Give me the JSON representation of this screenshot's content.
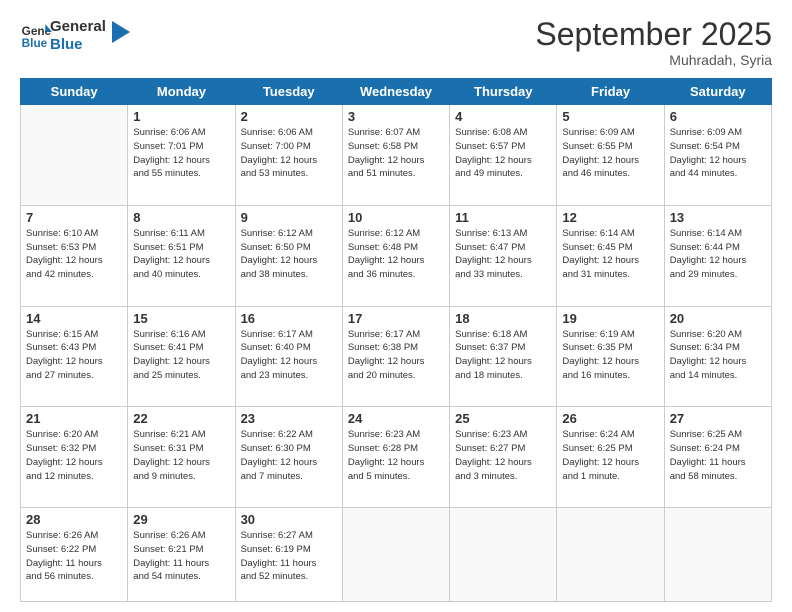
{
  "header": {
    "logo_general": "General",
    "logo_blue": "Blue",
    "month": "September 2025",
    "location": "Muhradah, Syria"
  },
  "days_of_week": [
    "Sunday",
    "Monday",
    "Tuesday",
    "Wednesday",
    "Thursday",
    "Friday",
    "Saturday"
  ],
  "weeks": [
    [
      {
        "day": "",
        "info": ""
      },
      {
        "day": "1",
        "info": "Sunrise: 6:06 AM\nSunset: 7:01 PM\nDaylight: 12 hours\nand 55 minutes."
      },
      {
        "day": "2",
        "info": "Sunrise: 6:06 AM\nSunset: 7:00 PM\nDaylight: 12 hours\nand 53 minutes."
      },
      {
        "day": "3",
        "info": "Sunrise: 6:07 AM\nSunset: 6:58 PM\nDaylight: 12 hours\nand 51 minutes."
      },
      {
        "day": "4",
        "info": "Sunrise: 6:08 AM\nSunset: 6:57 PM\nDaylight: 12 hours\nand 49 minutes."
      },
      {
        "day": "5",
        "info": "Sunrise: 6:09 AM\nSunset: 6:55 PM\nDaylight: 12 hours\nand 46 minutes."
      },
      {
        "day": "6",
        "info": "Sunrise: 6:09 AM\nSunset: 6:54 PM\nDaylight: 12 hours\nand 44 minutes."
      }
    ],
    [
      {
        "day": "7",
        "info": "Sunrise: 6:10 AM\nSunset: 6:53 PM\nDaylight: 12 hours\nand 42 minutes."
      },
      {
        "day": "8",
        "info": "Sunrise: 6:11 AM\nSunset: 6:51 PM\nDaylight: 12 hours\nand 40 minutes."
      },
      {
        "day": "9",
        "info": "Sunrise: 6:12 AM\nSunset: 6:50 PM\nDaylight: 12 hours\nand 38 minutes."
      },
      {
        "day": "10",
        "info": "Sunrise: 6:12 AM\nSunset: 6:48 PM\nDaylight: 12 hours\nand 36 minutes."
      },
      {
        "day": "11",
        "info": "Sunrise: 6:13 AM\nSunset: 6:47 PM\nDaylight: 12 hours\nand 33 minutes."
      },
      {
        "day": "12",
        "info": "Sunrise: 6:14 AM\nSunset: 6:45 PM\nDaylight: 12 hours\nand 31 minutes."
      },
      {
        "day": "13",
        "info": "Sunrise: 6:14 AM\nSunset: 6:44 PM\nDaylight: 12 hours\nand 29 minutes."
      }
    ],
    [
      {
        "day": "14",
        "info": "Sunrise: 6:15 AM\nSunset: 6:43 PM\nDaylight: 12 hours\nand 27 minutes."
      },
      {
        "day": "15",
        "info": "Sunrise: 6:16 AM\nSunset: 6:41 PM\nDaylight: 12 hours\nand 25 minutes."
      },
      {
        "day": "16",
        "info": "Sunrise: 6:17 AM\nSunset: 6:40 PM\nDaylight: 12 hours\nand 23 minutes."
      },
      {
        "day": "17",
        "info": "Sunrise: 6:17 AM\nSunset: 6:38 PM\nDaylight: 12 hours\nand 20 minutes."
      },
      {
        "day": "18",
        "info": "Sunrise: 6:18 AM\nSunset: 6:37 PM\nDaylight: 12 hours\nand 18 minutes."
      },
      {
        "day": "19",
        "info": "Sunrise: 6:19 AM\nSunset: 6:35 PM\nDaylight: 12 hours\nand 16 minutes."
      },
      {
        "day": "20",
        "info": "Sunrise: 6:20 AM\nSunset: 6:34 PM\nDaylight: 12 hours\nand 14 minutes."
      }
    ],
    [
      {
        "day": "21",
        "info": "Sunrise: 6:20 AM\nSunset: 6:32 PM\nDaylight: 12 hours\nand 12 minutes."
      },
      {
        "day": "22",
        "info": "Sunrise: 6:21 AM\nSunset: 6:31 PM\nDaylight: 12 hours\nand 9 minutes."
      },
      {
        "day": "23",
        "info": "Sunrise: 6:22 AM\nSunset: 6:30 PM\nDaylight: 12 hours\nand 7 minutes."
      },
      {
        "day": "24",
        "info": "Sunrise: 6:23 AM\nSunset: 6:28 PM\nDaylight: 12 hours\nand 5 minutes."
      },
      {
        "day": "25",
        "info": "Sunrise: 6:23 AM\nSunset: 6:27 PM\nDaylight: 12 hours\nand 3 minutes."
      },
      {
        "day": "26",
        "info": "Sunrise: 6:24 AM\nSunset: 6:25 PM\nDaylight: 12 hours\nand 1 minute."
      },
      {
        "day": "27",
        "info": "Sunrise: 6:25 AM\nSunset: 6:24 PM\nDaylight: 11 hours\nand 58 minutes."
      }
    ],
    [
      {
        "day": "28",
        "info": "Sunrise: 6:26 AM\nSunset: 6:22 PM\nDaylight: 11 hours\nand 56 minutes."
      },
      {
        "day": "29",
        "info": "Sunrise: 6:26 AM\nSunset: 6:21 PM\nDaylight: 11 hours\nand 54 minutes."
      },
      {
        "day": "30",
        "info": "Sunrise: 6:27 AM\nSunset: 6:19 PM\nDaylight: 11 hours\nand 52 minutes."
      },
      {
        "day": "",
        "info": ""
      },
      {
        "day": "",
        "info": ""
      },
      {
        "day": "",
        "info": ""
      },
      {
        "day": "",
        "info": ""
      }
    ]
  ]
}
